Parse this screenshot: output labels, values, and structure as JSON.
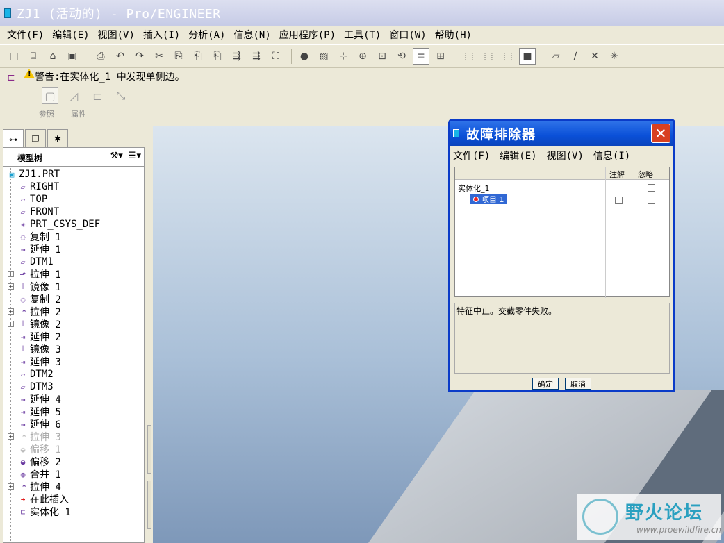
{
  "window": {
    "title": "ZJ1 (活动的) - Pro/ENGINEER"
  },
  "menu": [
    "文件(F)",
    "编辑(E)",
    "视图(V)",
    "插入(I)",
    "分析(A)",
    "信息(N)",
    "应用程序(P)",
    "工具(T)",
    "窗口(W)",
    "帮助(H)"
  ],
  "warning": {
    "text": "警告:在实体化_1 中发现单侧边。",
    "tabs": [
      "参照",
      "属性"
    ]
  },
  "tree": {
    "header": "模型树",
    "items": [
      {
        "label": "ZJ1.PRT",
        "icon": "part-icon",
        "expander": false,
        "disabled": false
      },
      {
        "label": "RIGHT",
        "icon": "datum-plane-icon",
        "expander": false,
        "disabled": false
      },
      {
        "label": "TOP",
        "icon": "datum-plane-icon",
        "expander": false,
        "disabled": false
      },
      {
        "label": "FRONT",
        "icon": "datum-plane-icon",
        "expander": false,
        "disabled": false
      },
      {
        "label": "PRT_CSYS_DEF",
        "icon": "csys-icon",
        "expander": false,
        "disabled": false
      },
      {
        "label": "复制 1",
        "icon": "copy-surface-icon",
        "expander": false,
        "disabled": false
      },
      {
        "label": "延伸 1",
        "icon": "extend-icon",
        "expander": false,
        "disabled": false
      },
      {
        "label": "DTM1",
        "icon": "datum-plane-icon",
        "expander": false,
        "disabled": false
      },
      {
        "label": "拉伸 1",
        "icon": "extrude-icon",
        "expander": true,
        "disabled": false
      },
      {
        "label": "镜像 1",
        "icon": "mirror-icon",
        "expander": true,
        "disabled": false
      },
      {
        "label": "复制 2",
        "icon": "copy-surface-icon",
        "expander": false,
        "disabled": false
      },
      {
        "label": "拉伸 2",
        "icon": "extrude-icon",
        "expander": true,
        "disabled": false
      },
      {
        "label": "镜像 2",
        "icon": "mirror-icon",
        "expander": true,
        "disabled": false
      },
      {
        "label": "延伸 2",
        "icon": "extend-icon",
        "expander": false,
        "disabled": false
      },
      {
        "label": "镜像 3",
        "icon": "mirror-icon",
        "expander": false,
        "disabled": false
      },
      {
        "label": "延伸 3",
        "icon": "extend-icon",
        "expander": false,
        "disabled": false
      },
      {
        "label": "DTM2",
        "icon": "datum-plane-icon",
        "expander": false,
        "disabled": false
      },
      {
        "label": "DTM3",
        "icon": "datum-plane-icon",
        "expander": false,
        "disabled": false
      },
      {
        "label": "延伸 4",
        "icon": "extend-icon",
        "expander": false,
        "disabled": false
      },
      {
        "label": "延伸 5",
        "icon": "extend-icon",
        "expander": false,
        "disabled": false
      },
      {
        "label": "延伸 6",
        "icon": "extend-icon",
        "expander": false,
        "disabled": false
      },
      {
        "label": "拉伸 3",
        "icon": "extrude-icon",
        "expander": true,
        "disabled": true
      },
      {
        "label": "偏移 1",
        "icon": "offset-icon",
        "expander": false,
        "disabled": true
      },
      {
        "label": "偏移 2",
        "icon": "offset-icon",
        "expander": false,
        "disabled": false
      },
      {
        "label": "合并 1",
        "icon": "merge-icon",
        "expander": false,
        "disabled": false
      },
      {
        "label": "拉伸 4",
        "icon": "extrude-icon",
        "expander": true,
        "disabled": false
      },
      {
        "label": "在此插入",
        "icon": "insert-here-icon",
        "expander": false,
        "disabled": false
      },
      {
        "label": "实体化 1",
        "icon": "solidify-icon",
        "expander": false,
        "disabled": false
      }
    ]
  },
  "dialog": {
    "title": "故障排除器",
    "menu": [
      "文件(F)",
      "编辑(E)",
      "视图(V)",
      "信息(I)"
    ],
    "columns": {
      "note": "注解",
      "ignore": "忽略"
    },
    "group": "实体化_1",
    "item": "项目 1",
    "message": "特征中止。交截零件失败。",
    "ok": "确定",
    "cancel": "取消"
  },
  "watermark": {
    "text": "野火论坛",
    "url": "www.proewildfire.cn"
  },
  "colors": {
    "title_bar": "#c6cbe6",
    "dialog_title": "#0a50d8",
    "selection": "#3168d4",
    "close": "#d84020"
  }
}
